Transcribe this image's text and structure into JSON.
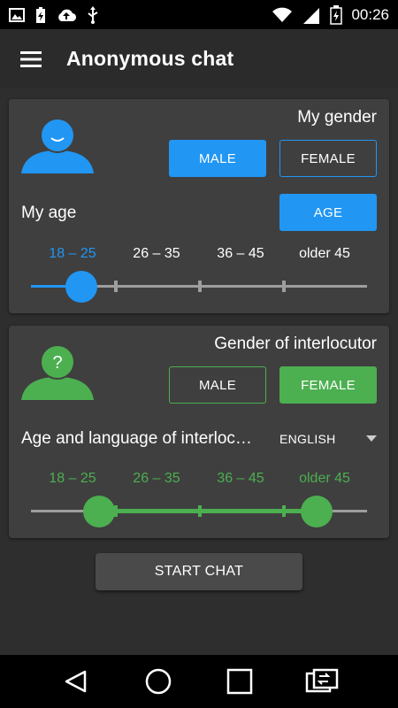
{
  "status_bar": {
    "time": "00:26",
    "icons": [
      "image-icon",
      "battery-charging-small-icon",
      "cloud-upload-icon",
      "usb-icon",
      "wifi-icon",
      "signal-icon",
      "battery-charging-icon"
    ]
  },
  "app_bar": {
    "title": "Anonymous chat",
    "menu_icon": "hamburger-menu-icon"
  },
  "my_card": {
    "gender_label": "My gender",
    "male_label": "MALE",
    "female_label": "FEMALE",
    "selected_gender": "MALE",
    "age_label": "My age",
    "age_button": "AGE",
    "age_ranges": [
      "18 – 25",
      "26 – 35",
      "36 – 45",
      "older 45"
    ],
    "selected_age_index": 0,
    "accent": "#2196f3"
  },
  "interlocutor_card": {
    "gender_label": "Gender of interlocutor",
    "male_label": "MALE",
    "female_label": "FEMALE",
    "selected_gender": "FEMALE",
    "age_language_label": "Age and language of interlocutor",
    "language": "ENGLISH",
    "age_ranges": [
      "18 – 25",
      "26 – 35",
      "36 – 45",
      "older 45"
    ],
    "selected_range": [
      0,
      3
    ],
    "avatar_symbol": "?",
    "accent": "#4caf50"
  },
  "start_button": "START CHAT",
  "nav_bar": {
    "icons": [
      "back-icon",
      "home-icon",
      "recents-icon",
      "screen-rotate-icon"
    ]
  }
}
